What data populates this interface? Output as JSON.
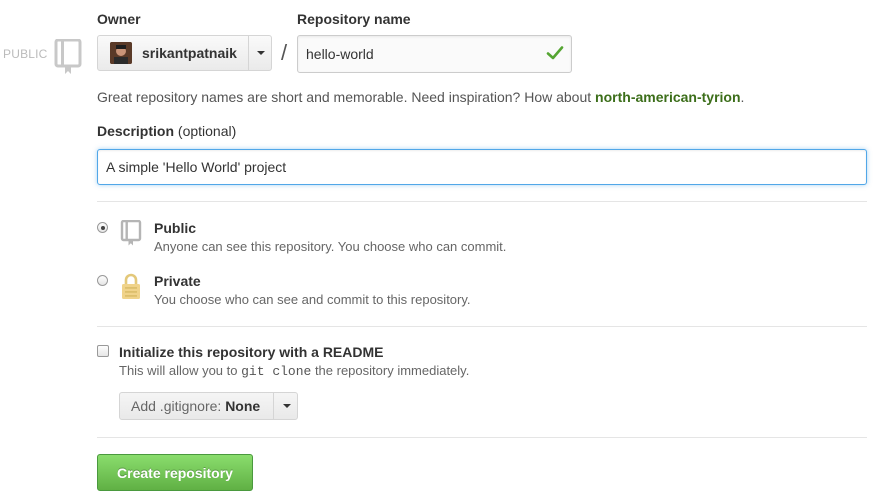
{
  "owner": {
    "label": "Owner",
    "selected": "srikantpatnaik",
    "visibility_tag": "PUBLIC"
  },
  "separator": "/",
  "repo": {
    "label": "Repository name",
    "value": "hello-world",
    "hint_prefix": "Great repository names are short and memorable. Need inspiration? How about ",
    "hint_suggestion": "north-american-tyrion",
    "hint_suffix": "."
  },
  "description": {
    "label": "Description",
    "optional": "(optional)",
    "value": "A simple 'Hello World' project"
  },
  "visibility": [
    {
      "title": "Public",
      "note": "Anyone can see this repository. You choose who can commit.",
      "selected": true,
      "icon": "repo-icon"
    },
    {
      "title": "Private",
      "note": "You choose who can see and commit to this repository.",
      "selected": false,
      "icon": "lock-icon"
    }
  ],
  "readme": {
    "label": "Initialize this repository with a README",
    "note_prefix": "This will allow you to ",
    "note_code": "git clone",
    "note_suffix": " the repository immediately.",
    "checked": false
  },
  "gitignore": {
    "prefix": "Add .gitignore:",
    "value": "None"
  },
  "create_button": "Create repository",
  "colors": {
    "accent_green": "#60b044",
    "link_green": "#3c6e1a",
    "focus_blue": "#51a7e8"
  }
}
